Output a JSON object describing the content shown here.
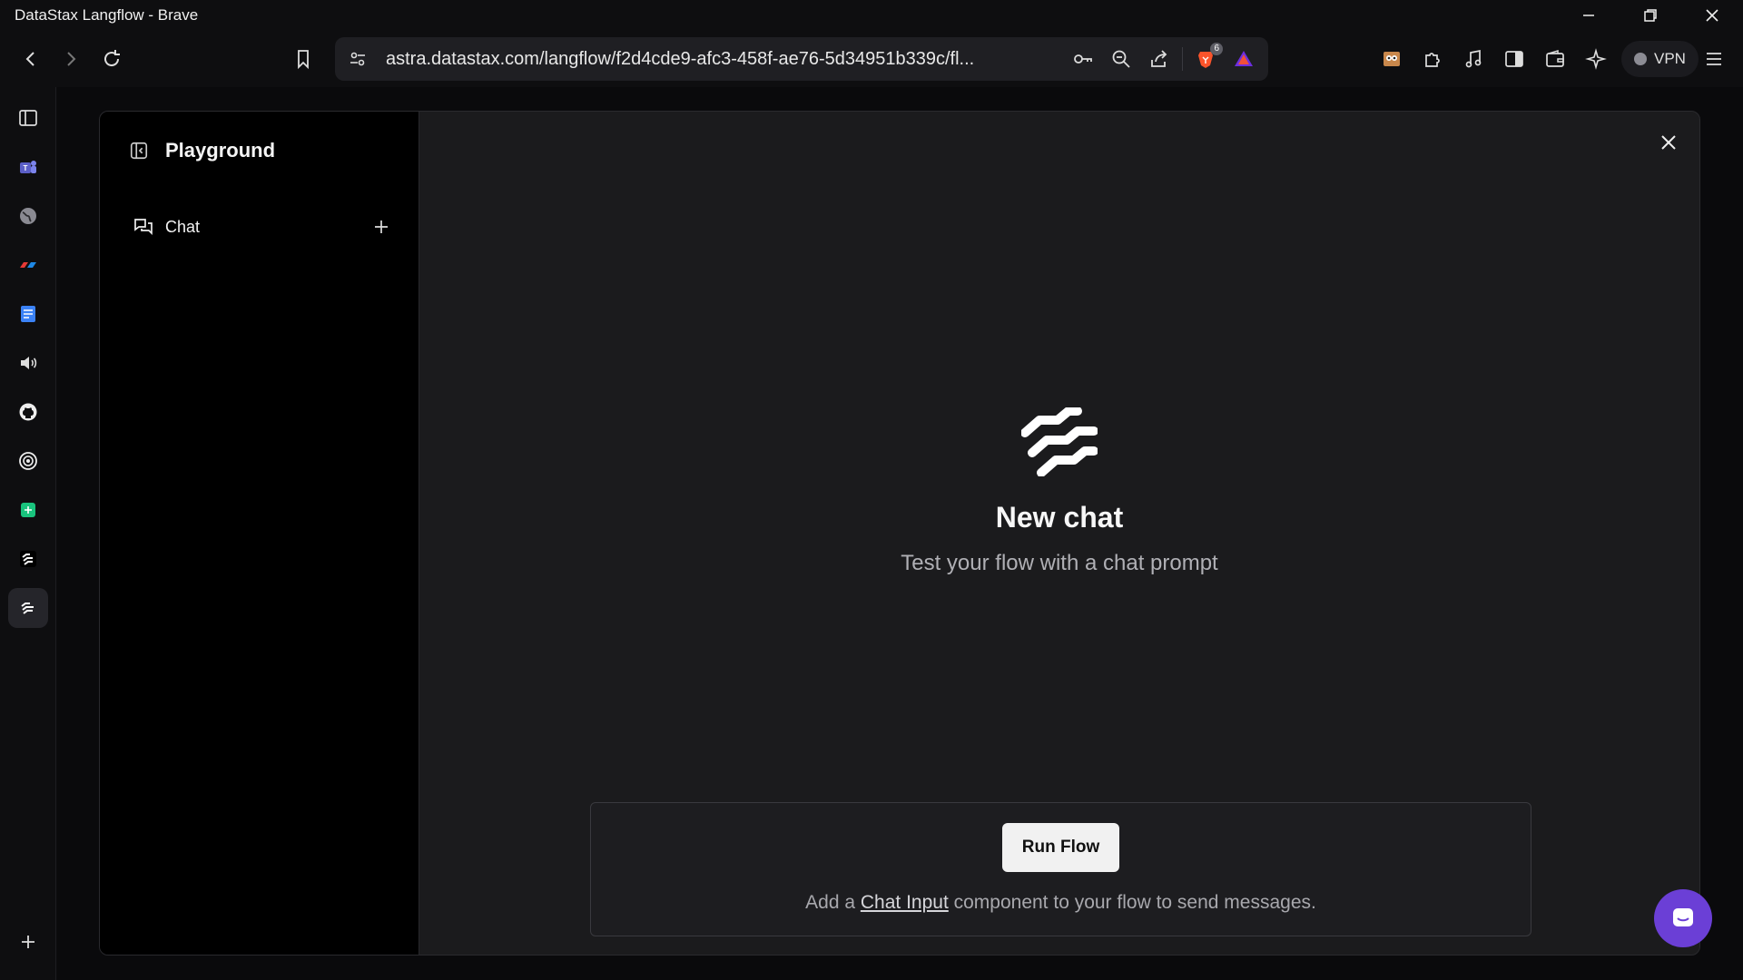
{
  "window": {
    "title": "DataStax Langflow - Brave"
  },
  "toolbar": {
    "url": "astra.datastax.com/langflow/f2d4cde9-afc3-458f-ae76-5d34951b339c/fl...",
    "brave_shield_count": "6",
    "vpn_label": "VPN"
  },
  "playground": {
    "title": "Playground",
    "chat_label": "Chat"
  },
  "empty_state": {
    "title": "New chat",
    "subtitle": "Test your flow with a chat prompt"
  },
  "input_panel": {
    "run_button": "Run Flow",
    "hint_prefix": "Add a ",
    "hint_link": "Chat Input",
    "hint_suffix": " component to your flow to send messages."
  },
  "colors": {
    "accent_launcher": "#6b3fd6",
    "modal_bg": "#1b1b1d",
    "sidebar_bg": "#000000"
  },
  "icons": {
    "rail": [
      "sidebar-toggle-icon",
      "teams-icon",
      "globe-icon",
      "app-icon",
      "docs-icon",
      "speaker-icon",
      "github-icon",
      "openai-icon",
      "sheets-icon",
      "langflow-icon",
      "langflow-active-icon",
      "add-icon"
    ]
  }
}
